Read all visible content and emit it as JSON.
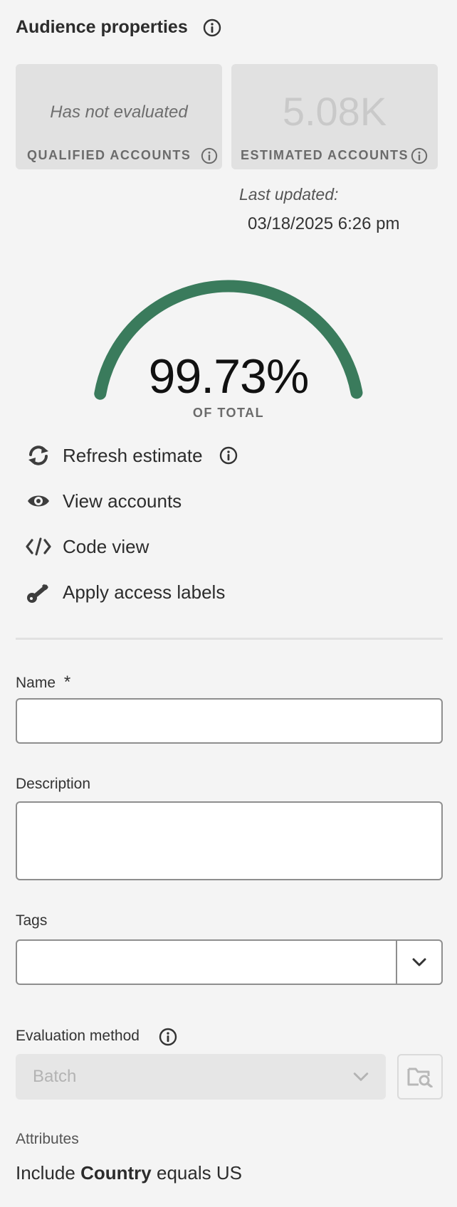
{
  "panel": {
    "title": "Audience properties"
  },
  "cards": {
    "qualified": {
      "value": "Has not evaluated",
      "label": "QUALIFIED ACCOUNTS"
    },
    "estimated": {
      "value": "5.08K",
      "label": "ESTIMATED ACCOUNTS"
    }
  },
  "last_updated": {
    "label": "Last updated:",
    "datetime": "03/18/2025 6:26 pm"
  },
  "gauge": {
    "percent_text": "99.73%",
    "caption": "OF TOTAL",
    "percent_value": 99.73,
    "color": "#3a7b5c"
  },
  "actions": {
    "refresh": "Refresh estimate",
    "view": "View accounts",
    "code": "Code view",
    "labels": "Apply access labels"
  },
  "form": {
    "name": {
      "label": "Name",
      "required_mark": "*",
      "value": ""
    },
    "description": {
      "label": "Description",
      "value": ""
    },
    "tags": {
      "label": "Tags",
      "value": ""
    },
    "evaluation_method": {
      "label": "Evaluation method",
      "value": "Batch"
    }
  },
  "attributes": {
    "label": "Attributes",
    "prefix": "Include",
    "field": "Country",
    "suffix": "equals US"
  },
  "colors": {
    "background": "#f4f4f4",
    "card": "#e1e1e1",
    "accent_green": "#3a7b5c"
  },
  "icons": [
    "info-icon",
    "refresh-icon",
    "eye-icon",
    "code-icon",
    "key-icon",
    "chevron-down-icon",
    "folder-search-icon"
  ]
}
